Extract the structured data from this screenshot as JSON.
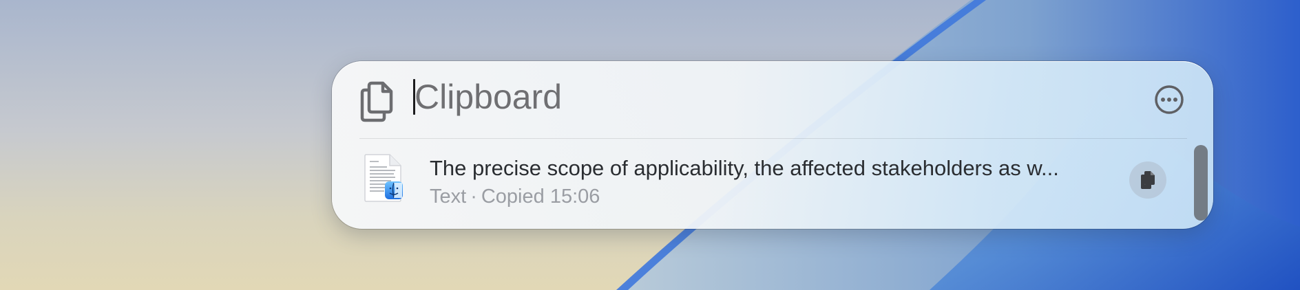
{
  "search": {
    "placeholder": "Clipboard",
    "value": ""
  },
  "results": [
    {
      "title": "The precise scope of applicability, the affected stakeholders as w...",
      "kind": "Text",
      "separator": "·",
      "copied": "Copied 15:06"
    }
  ],
  "icons": {
    "search_mode": "clipboard-icon",
    "more": "ellipsis-circle-icon",
    "thumbnail": "text-document-icon",
    "badge": "finder-icon",
    "copy": "copy-icon"
  },
  "colors": {
    "wallpaper_top": "#a9b6cd",
    "wallpaper_bottom": "#e2d8b6",
    "wallpaper_accent": "#2f6fd6",
    "title_text": "#2a2d31",
    "meta_text": "#9a9da3",
    "placeholder_text": "#6f6f72"
  }
}
